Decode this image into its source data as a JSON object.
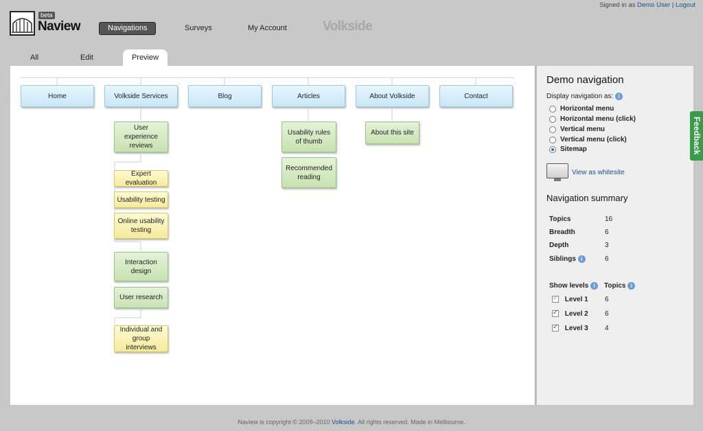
{
  "topbar": {
    "signed_in_prefix": "Signed in as",
    "user_name": "Demo User",
    "separator": "|",
    "logout": "Logout"
  },
  "logo": {
    "badge": "beta",
    "name": "Naview"
  },
  "mainnav": {
    "items": [
      "Navigations",
      "Surveys",
      "My Account"
    ],
    "active": "Navigations"
  },
  "brand": "Volkside",
  "tabs": [
    "All",
    "Edit",
    "Preview"
  ],
  "active_tab": "Preview",
  "sitemap": {
    "level1": [
      "Home",
      "Volkside Services",
      "Blog",
      "Articles",
      "About Volkside",
      "Contact"
    ],
    "services": {
      "ux_reviews": "User experience reviews",
      "expert_eval": "Expert evaluation",
      "usability_testing": "Usability testing",
      "online_testing": "Online usability testing",
      "interaction_design": "Interaction design",
      "user_research": "User research",
      "interviews": "Individual and group interviews"
    },
    "articles": {
      "rules": "Usability rules of thumb",
      "reading": "Recommended reading"
    },
    "about": {
      "site": "About this site"
    }
  },
  "side": {
    "title": "Demo navigation",
    "display_label": "Display navigation as:",
    "options": [
      "Horizontal menu",
      "Horizontal menu (click)",
      "Vertical menu",
      "Vertical menu (click)",
      "Sitemap"
    ],
    "selected_option": "Sitemap",
    "view_whitesite": "View as whitesite",
    "summary_title": "Navigation summary",
    "stats": [
      {
        "label": "Topics",
        "value": "16"
      },
      {
        "label": "Breadth",
        "value": "6"
      },
      {
        "label": "Depth",
        "value": "3"
      },
      {
        "label": "Siblings",
        "value": "6"
      }
    ],
    "levels_header": "Show levels",
    "topics_header": "Topics",
    "levels": [
      {
        "label": "Level 1",
        "count": "6"
      },
      {
        "label": "Level 2",
        "count": "6"
      },
      {
        "label": "Level 3",
        "count": "4"
      }
    ]
  },
  "feedback": "Feedback",
  "footer": {
    "text": "Naview is copyright © 2009–2010",
    "link": "Volkside",
    "rest": ". All rights reserved. Made in Melbourne."
  },
  "colors": {
    "level1": "#d4eefa",
    "level2": "#d6ebc4",
    "level3": "#fbf3b8",
    "feedback": "#3c9a4c",
    "active_nav": "#555555"
  }
}
